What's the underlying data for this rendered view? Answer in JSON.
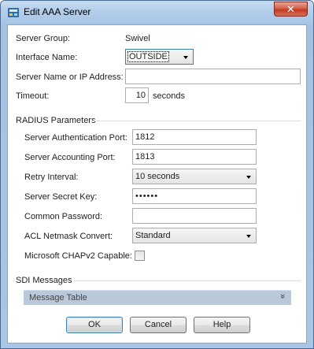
{
  "window": {
    "title": "Edit AAA Server",
    "close_label": "✕"
  },
  "fields": {
    "server_group_label": "Server Group:",
    "server_group_value": "Swivel",
    "interface_name_label": "Interface Name:",
    "interface_name_value": "OUTSIDE",
    "server_name_label": "Server Name or IP Address:",
    "server_name_value": "",
    "timeout_label": "Timeout:",
    "timeout_value": "10",
    "timeout_unit": "seconds"
  },
  "radius": {
    "section_title": "RADIUS Parameters",
    "auth_port_label": "Server Authentication Port:",
    "auth_port_value": "1812",
    "acct_port_label": "Server Accounting Port:",
    "acct_port_value": "1813",
    "retry_label": "Retry Interval:",
    "retry_value": "10 seconds",
    "secret_label": "Server Secret Key:",
    "secret_value": "••••••",
    "common_pw_label": "Common Password:",
    "common_pw_value": "",
    "acl_label": "ACL Netmask Convert:",
    "acl_value": "Standard",
    "chap_label": "Microsoft CHAPv2 Capable:",
    "chap_checked": false
  },
  "sdi": {
    "section_title": "SDI Messages",
    "table_label": "Message Table",
    "expand_glyph": "»"
  },
  "buttons": {
    "ok": "OK",
    "cancel": "Cancel",
    "help": "Help"
  },
  "colors": {
    "titlebar": "#b2cdea",
    "close": "#c2391f",
    "focus": "#3c7fb1"
  }
}
